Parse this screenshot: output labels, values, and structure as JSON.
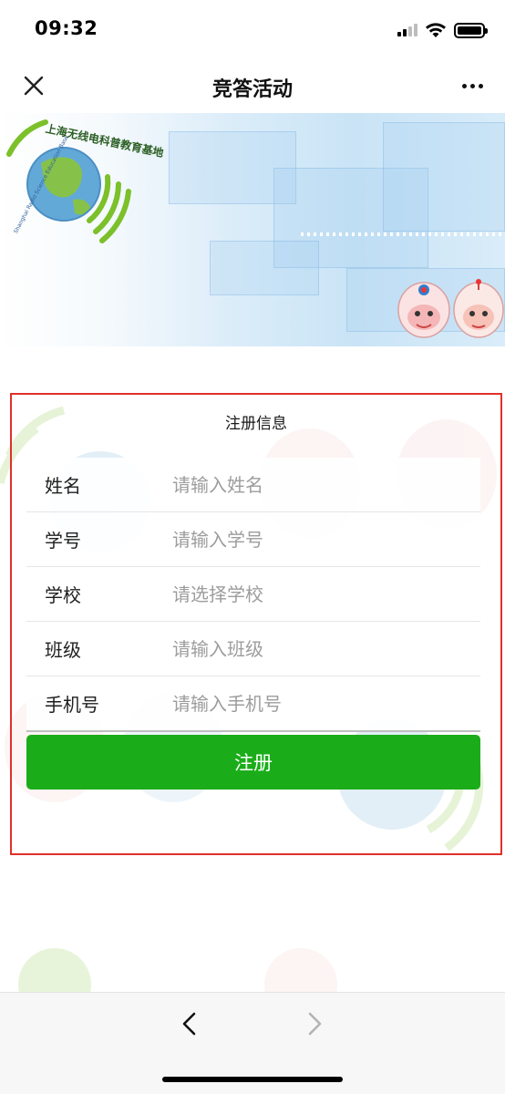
{
  "status_bar": {
    "time": "09:32",
    "icons": [
      "signal-icon",
      "wifi-icon",
      "battery-icon"
    ]
  },
  "nav": {
    "title": "竞答活动",
    "close_icon": "close-icon",
    "more_icon": "more-icon"
  },
  "banner": {
    "logo_text": "上海无线电科普教育基地",
    "logo_subtext": "Shanghai Radio Science Education Base"
  },
  "form": {
    "heading": "注册信息",
    "fields": [
      {
        "label": "姓名",
        "placeholder": "请输入姓名"
      },
      {
        "label": "学号",
        "placeholder": "请输入学号"
      },
      {
        "label": "学校",
        "placeholder": "请选择学校"
      },
      {
        "label": "班级",
        "placeholder": "请输入班级"
      },
      {
        "label": "手机号",
        "placeholder": "请输入手机号"
      }
    ],
    "submit_label": "注册"
  },
  "toolbar": {
    "back_icon": "back-arrow-icon",
    "forward_icon": "forward-arrow-icon"
  },
  "colors": {
    "primary_button": "#1aad19",
    "form_border": "#e0302b",
    "logo_green": "#7cc02a",
    "placeholder": "#9d9d9d"
  }
}
